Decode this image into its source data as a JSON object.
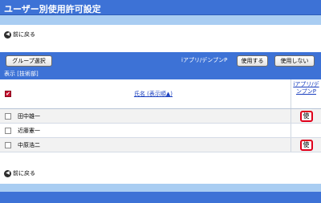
{
  "header": {
    "title": "ユーザー別使用許可設定"
  },
  "nav": {
    "back_label": "前に戻る"
  },
  "toolbar": {
    "group_select": "グループ選択",
    "app_label": "iアプリ/デンプンP",
    "use_button": "使用する",
    "not_use_button": "使用しない",
    "dept_label": "表示 [技術部]"
  },
  "table": {
    "select_all_mark": "✔",
    "name_header": "氏名 (表示順▲)",
    "app_header": "iアプリ/デンプンP",
    "rows": [
      {
        "name": "田中雄一",
        "app_status": "使"
      },
      {
        "name": "近藤憲一",
        "app_status": ""
      },
      {
        "name": "中原浩二",
        "app_status": "使"
      }
    ]
  },
  "colors": {
    "header_blue": "#3d72d6",
    "light_blue": "#a9cdf2",
    "highlight_red": "#e0001b"
  }
}
